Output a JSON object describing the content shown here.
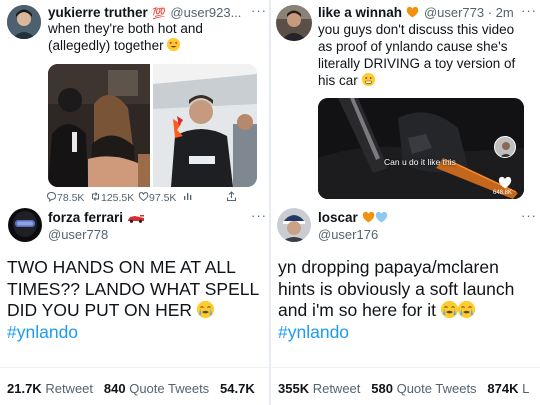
{
  "tl": {
    "name": "yukierre truther",
    "badge": "💯",
    "handle": "@user923...",
    "text_line1": "when they're both hot and",
    "text_line2": "(allegedly) together",
    "replies": "78.5K",
    "retweets": "125.5K",
    "likes": "97.5K"
  },
  "tr": {
    "name": "like a winnah",
    "handle": "@user773 · 2m",
    "text_line1": "you guys don't discuss this video",
    "text_line2": "as proof of ynlando cause she's",
    "text_line3": "literally DRIVING a toy version of",
    "text_line4": "his car",
    "video_caption": "Can u do it like this",
    "video_likes": "648.8K"
  },
  "bl": {
    "name": "forza ferrari",
    "handle": "@user778",
    "text_line1": "TWO HANDS ON ME AT ALL",
    "text_line2": "TIMES?? LANDO WHAT SPELL",
    "text_line3": "DID YOU PUT ON HER",
    "hashtag": "#ynlando",
    "retweets": "21.7K",
    "retweets_label": "Retweet",
    "quotes": "840",
    "quotes_label": "Quote Tweets",
    "likes": "54.7K"
  },
  "br": {
    "name": "loscar",
    "handle": "@user176",
    "text_line1": "yn dropping papaya/mclaren",
    "text_line2": "hints is obviously a soft launch",
    "text_line3": "and i'm so here for it",
    "hashtag": "#ynlando",
    "retweets": "355K",
    "retweets_label": "Retweet",
    "quotes": "580",
    "quotes_label": "Quote Tweets",
    "likes": "874K",
    "likes_label": "L"
  },
  "more_label": "···",
  "colors": {
    "accent": "#1d9bf0",
    "text": "#0f1419",
    "muted": "#536471",
    "divider": "#eff3f4"
  }
}
